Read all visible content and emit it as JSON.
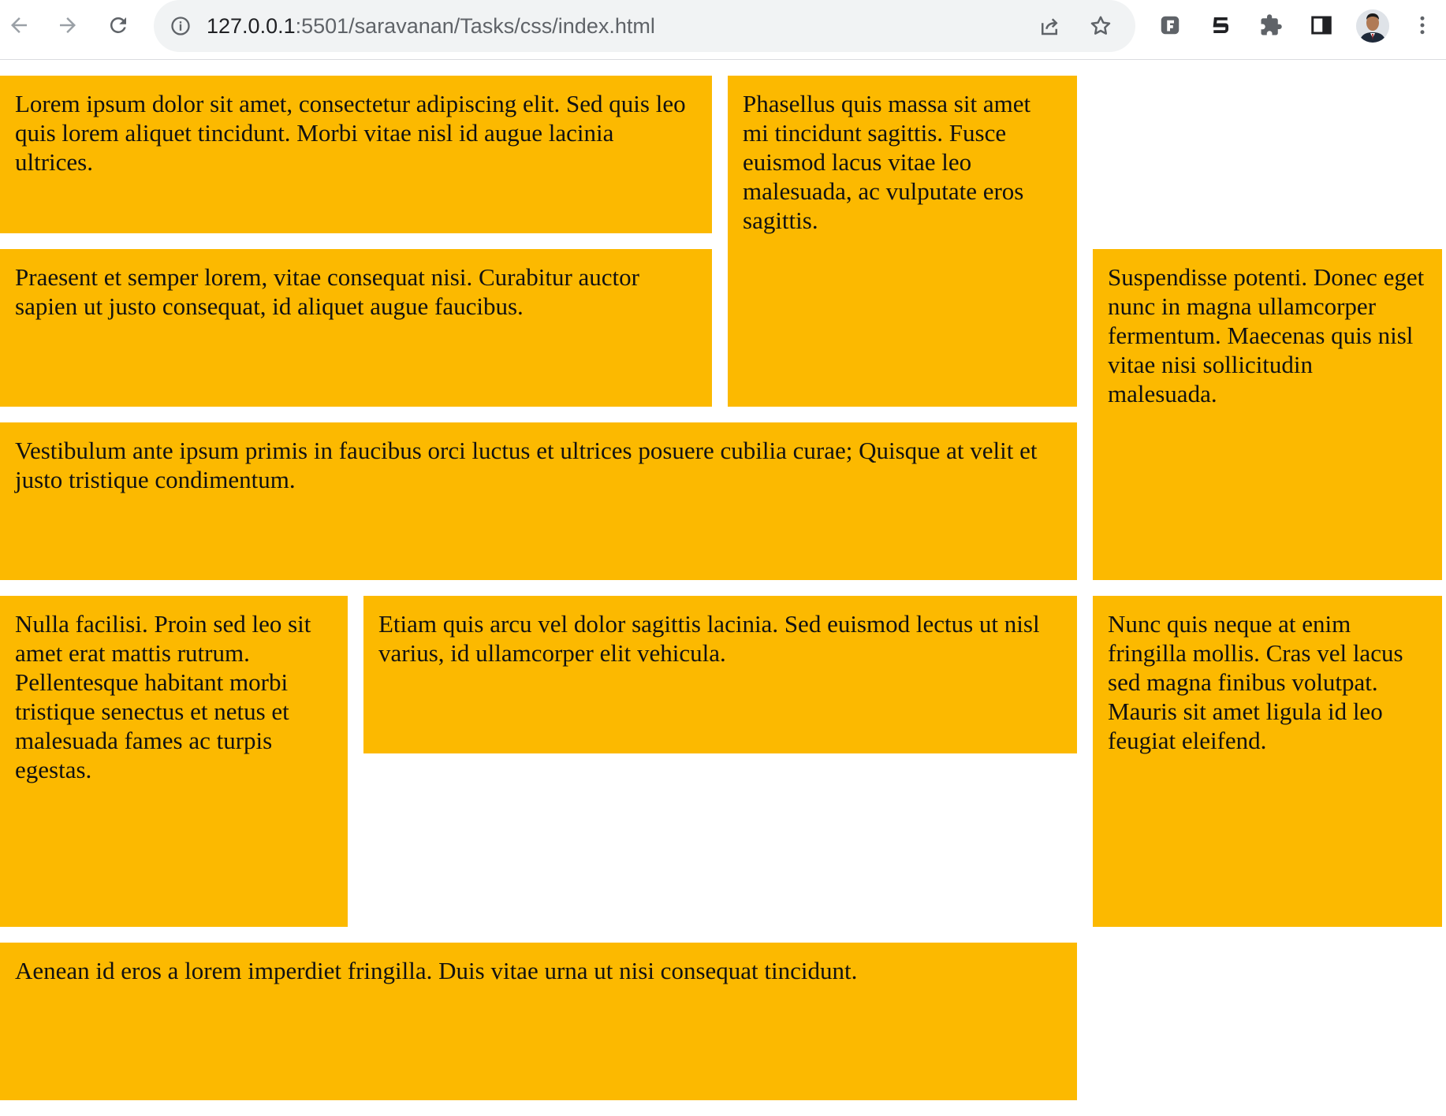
{
  "browser": {
    "url_host": "127.0.0.1",
    "url_rest": ":5501/saravanan/Tasks/css/index.html",
    "icons": [
      "back-arrow-icon",
      "forward-arrow-icon",
      "reload-icon",
      "info-icon",
      "share-icon",
      "star-icon",
      "extension-f-icon",
      "extension-5-icon",
      "puzzle-icon",
      "side-panel-icon",
      "avatar",
      "kebab-menu-icon"
    ]
  },
  "colors": {
    "box_background": "#fcb900",
    "page_background": "#ffffff"
  },
  "boxes": [
    {
      "text": "Lorem ipsum dolor sit amet, consectetur adipiscing elit. Sed quis leo quis lorem aliquet tincidunt. Morbi vitae nisl id augue lacinia ultrices."
    },
    {
      "text": "Phasellus quis massa sit amet mi tincidunt sagittis. Fusce euismod lacus vitae leo malesuada, ac vulputate eros sagittis."
    },
    {
      "text": "Praesent et semper lorem, vitae consequat nisi. Curabitur auctor sapien ut justo consequat, id aliquet augue faucibus."
    },
    {
      "text": "Suspendisse potenti. Donec eget nunc in magna ullamcorper fermentum. Maecenas quis nisl vitae nisi sollicitudin malesuada."
    },
    {
      "text": "Vestibulum ante ipsum primis in faucibus orci luctus et ultrices posuere cubilia curae; Quisque at velit et justo tristique condimentum."
    },
    {
      "text": "Nulla facilisi. Proin sed leo sit amet erat mattis rutrum. Pellentesque habitant morbi tristique senectus et netus et malesuada fames ac turpis egestas."
    },
    {
      "text": "Etiam quis arcu vel dolor sagittis lacinia. Sed euismod lectus ut nisl varius, id ullamcorper elit vehicula."
    },
    {
      "text": "Nunc quis neque at enim fringilla mollis. Cras vel lacus sed magna finibus volutpat. Mauris sit amet ligula id leo feugiat eleifend."
    },
    {
      "text": "Aenean id eros a lorem imperdiet fringilla. Duis vitae urna ut nisi consequat tincidunt."
    }
  ]
}
